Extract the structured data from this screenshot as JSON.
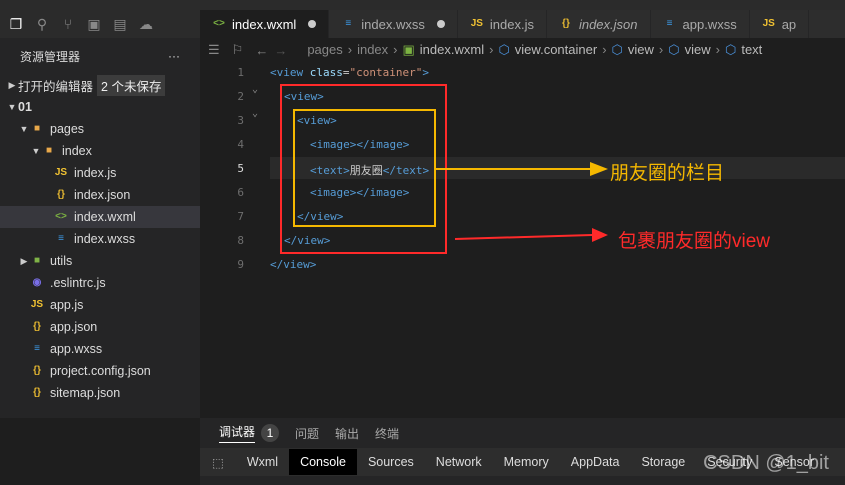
{
  "activity_icons": [
    "files-icon",
    "search-icon",
    "source-control-icon",
    "extensions-icon",
    "storage-icon",
    "docker-icon"
  ],
  "sidebar": {
    "title": "资源管理器",
    "more": "···",
    "open_editors": "打开的编辑器",
    "unsaved": "2 个未保存",
    "project": "01",
    "tree": [
      {
        "label": "pages",
        "depth": 1,
        "type": "folder-open",
        "icon": "📁"
      },
      {
        "label": "index",
        "depth": 2,
        "type": "folder-open"
      },
      {
        "label": "index.js",
        "depth": 3,
        "type": "js"
      },
      {
        "label": "index.json",
        "depth": 3,
        "type": "json"
      },
      {
        "label": "index.wxml",
        "depth": 3,
        "type": "wxml",
        "selected": true
      },
      {
        "label": "index.wxss",
        "depth": 3,
        "type": "wxss"
      },
      {
        "label": "utils",
        "depth": 1,
        "type": "folder"
      },
      {
        "label": ".eslintrc.js",
        "depth": 1,
        "type": "eslint"
      },
      {
        "label": "app.js",
        "depth": 1,
        "type": "js"
      },
      {
        "label": "app.json",
        "depth": 1,
        "type": "json"
      },
      {
        "label": "app.wxss",
        "depth": 1,
        "type": "wxss"
      },
      {
        "label": "project.config.json",
        "depth": 1,
        "type": "json"
      },
      {
        "label": "sitemap.json",
        "depth": 1,
        "type": "json"
      }
    ]
  },
  "tabs": [
    {
      "label": "index.wxml",
      "type": "wxml",
      "dirty": true,
      "active": true
    },
    {
      "label": "index.wxss",
      "type": "wxss",
      "dirty": true
    },
    {
      "label": "index.js",
      "type": "js"
    },
    {
      "label": "index.json",
      "type": "json"
    },
    {
      "label": "app.wxss",
      "type": "wxss"
    },
    {
      "label": "ap",
      "type": "js"
    }
  ],
  "breadcrumb": [
    "pages",
    "index",
    "index.wxml",
    "view.container",
    "view",
    "view",
    "text"
  ],
  "code": {
    "lines": [
      "1",
      "2",
      "3",
      "4",
      "5",
      "6",
      "7",
      "8",
      "9"
    ],
    "current_line": "5"
  },
  "annotations": {
    "inner": "朋友圈的栏目",
    "outer": "包裹朋友圈的view",
    "inner_color": "#f5b800",
    "outer_color": "#ff2a2a"
  },
  "panel": {
    "tabs": [
      "调试器",
      "问题",
      "输出",
      "终端"
    ],
    "count": "1",
    "devtools": [
      "Wxml",
      "Console",
      "Sources",
      "Network",
      "Memory",
      "AppData",
      "Storage",
      "Security",
      "Sensor"
    ]
  },
  "watermark": "CSDN @1_bit"
}
